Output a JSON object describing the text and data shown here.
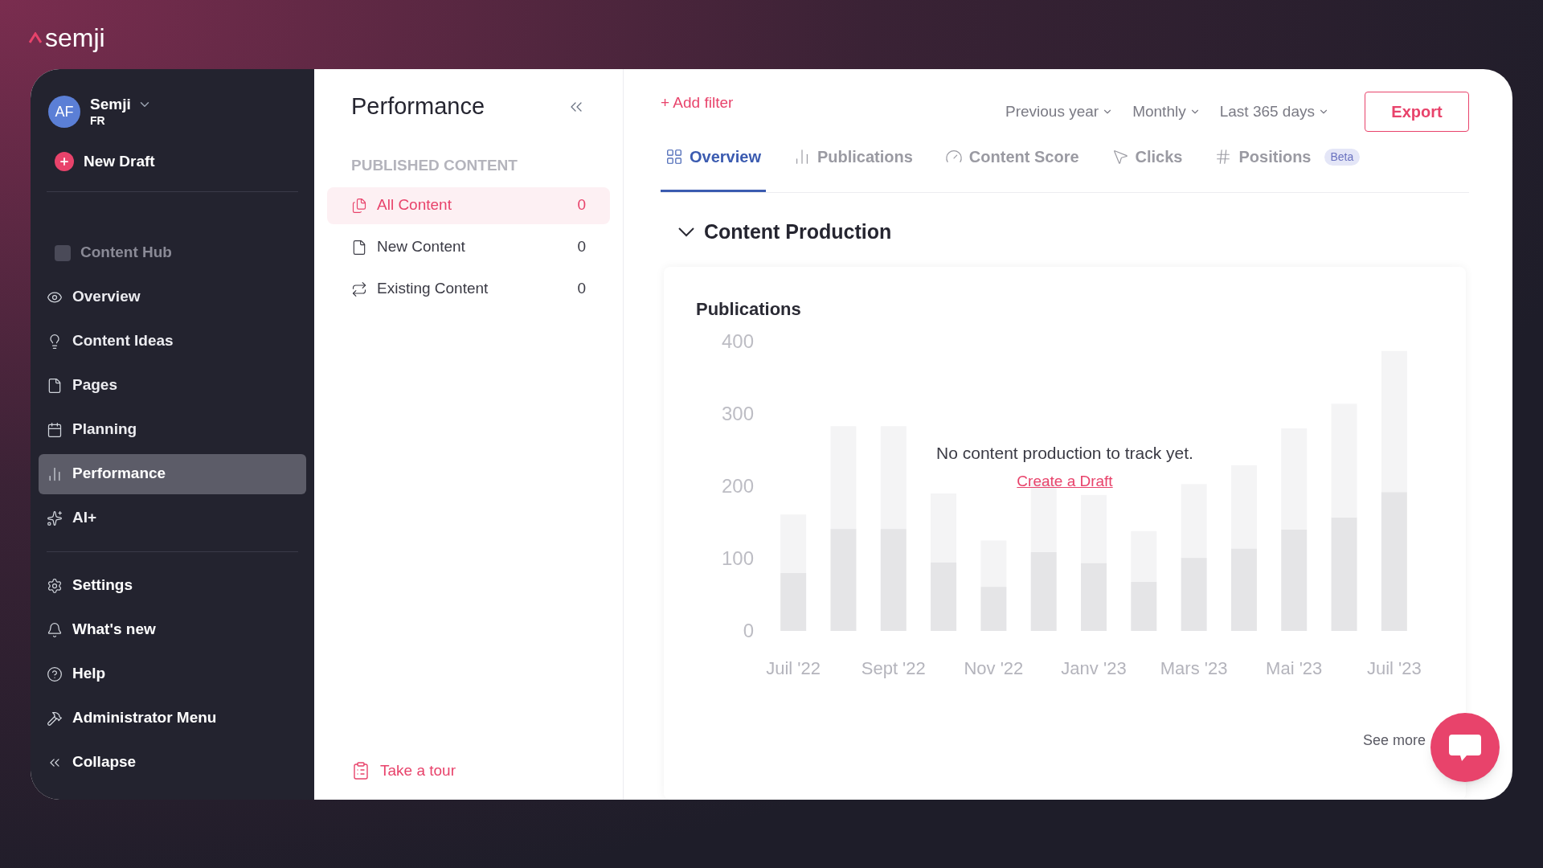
{
  "brand": {
    "name": "semji"
  },
  "account": {
    "initials": "AF",
    "name": "Semji",
    "locale": "FR"
  },
  "new_draft": {
    "label": "New Draft"
  },
  "sidebar": {
    "items": [
      {
        "kind": "section",
        "label": "Content Hub"
      },
      {
        "kind": "link",
        "label": "Overview",
        "selected": false
      },
      {
        "kind": "link",
        "label": "Content Ideas",
        "selected": false
      },
      {
        "kind": "link",
        "label": "Pages",
        "selected": false
      },
      {
        "kind": "link",
        "label": "Planning",
        "selected": false
      },
      {
        "kind": "link",
        "label": "Performance",
        "selected": true
      },
      {
        "kind": "link",
        "label": "AI+",
        "selected": false
      }
    ],
    "footer_items": [
      {
        "label": "Settings"
      },
      {
        "label": "What's new"
      },
      {
        "label": "Help"
      },
      {
        "label": "Administrator Menu"
      },
      {
        "label": "Collapse"
      }
    ]
  },
  "panel": {
    "title": "Performance",
    "section": "PUBLISHED CONTENT",
    "items": [
      {
        "label": "All Content",
        "count": "0",
        "selected": true
      },
      {
        "label": "New Content",
        "count": "0",
        "selected": false
      },
      {
        "label": "Existing Content",
        "count": "0",
        "selected": false
      }
    ],
    "tour": "Take a tour"
  },
  "toolbar": {
    "add_filter": "+ Add filter",
    "filters": [
      "Previous year",
      "Monthly",
      "Last 365 days"
    ],
    "export": "Export"
  },
  "tabs": [
    {
      "label": "Overview",
      "selected": true
    },
    {
      "label": "Publications",
      "selected": false
    },
    {
      "label": "Content Score",
      "selected": false
    },
    {
      "label": "Clicks",
      "selected": false
    },
    {
      "label": "Positions",
      "selected": false,
      "badge": "Beta"
    }
  ],
  "section": {
    "title": "Content Production",
    "expanded": true,
    "card": {
      "title": "Publications",
      "empty_message": "No content production to track yet.",
      "empty_link": "Create a Draft",
      "see_more": "See more",
      "chart_data": {
        "type": "bar",
        "stacked": true,
        "categories": [
          "Juil '22",
          null,
          "Sept '22",
          null,
          "Nov '22",
          null,
          "Janv '23",
          null,
          "Mars '23",
          null,
          "Mai '23",
          null,
          "Juil '23"
        ],
        "series": [
          {
            "color": "#e5e5e7",
            "values": [
              80,
              141,
              141,
              95,
              61,
              109,
              94,
              68,
              101,
              114,
              140,
              157,
              192
            ]
          },
          {
            "color": "#f4f4f5",
            "values": [
              81,
              142,
              142,
              95,
              64,
              98,
              94,
              70,
              102,
              115,
              140,
              157,
              195
            ]
          }
        ],
        "ylim": [
          0,
          400
        ],
        "yticks": [
          0,
          100,
          200,
          300,
          400
        ]
      }
    }
  }
}
